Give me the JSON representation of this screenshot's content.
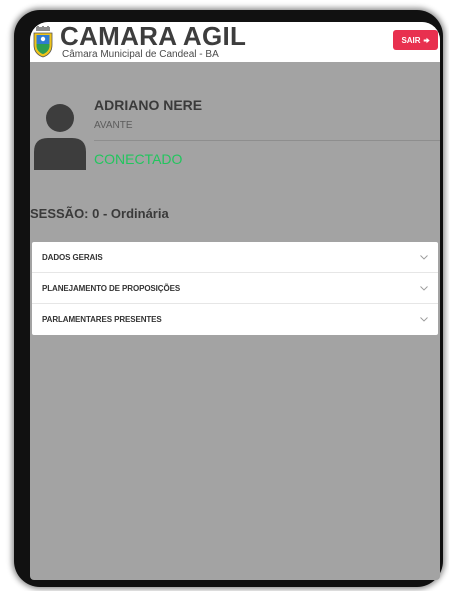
{
  "header": {
    "title": "CAMARA AGIL",
    "subtitle": "Câmara Municipal de Candeal - BA",
    "logout_label": "SAIR",
    "logout_color": "#e8304f",
    "logo_icon": "coat-of-arms-icon"
  },
  "profile": {
    "name": "ADRIANO NERE",
    "party": "AVANTE",
    "status": "CONECTADO",
    "status_color": "#22c55e",
    "avatar_icon": "user-silhouette-icon"
  },
  "session": {
    "title": "SESSÃO: 0 - Ordinária"
  },
  "accordion": {
    "items": [
      {
        "label": "DADOS GERAIS",
        "icon": "chevron-down-icon"
      },
      {
        "label": "PLANEJAMENTO DE PROPOSIÇÕES",
        "icon": "chevron-down-icon"
      },
      {
        "label": "PARLAMENTARES PRESENTES",
        "icon": "chevron-down-icon"
      }
    ]
  }
}
